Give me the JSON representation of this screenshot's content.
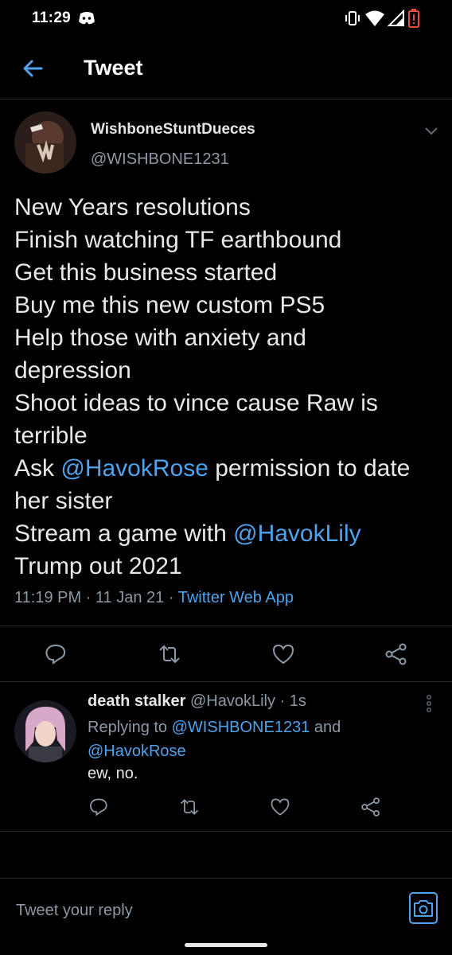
{
  "status_bar": {
    "time": "11:29",
    "icons": [
      "discord-icon",
      "vibrate-icon",
      "wifi-icon",
      "signal-icon",
      "battery-low-icon"
    ]
  },
  "header": {
    "back_icon": "arrow-left-icon",
    "title": "Tweet"
  },
  "tweet": {
    "author_name": "WishboneStuntDueces",
    "author_handle": "@WISHBONE1231",
    "lines": [
      {
        "text": "New Years resolutions"
      },
      {
        "text": "Finish watching TF earthbound"
      },
      {
        "text": "Get this business started"
      },
      {
        "text": "Buy me this new custom PS5"
      },
      {
        "text": "Help those with anxiety and"
      },
      {
        "text": "depression"
      },
      {
        "text": "Shoot ideas to vince cause Raw is"
      },
      {
        "text": "terrible"
      },
      {
        "before": "Ask ",
        "mention": "@HavokRose",
        "after": " permission to date"
      },
      {
        "text": "her sister"
      },
      {
        "before": "Stream a game with ",
        "mention": "@HavokLily",
        "after": ""
      },
      {
        "text": "Trump out 2021"
      }
    ],
    "time": "11:19 PM",
    "date": "11 Jan 21",
    "separator": " · ",
    "source": "Twitter Web App",
    "actions": [
      "reply-icon",
      "retweet-icon",
      "like-icon",
      "share-icon"
    ]
  },
  "reply": {
    "author_name": "death stalker",
    "author_handle": "@HavokLily",
    "age": "1s",
    "replying_prefix": "Replying to ",
    "replying_to_1": "@WISHBONE1231",
    "replying_and": " and",
    "replying_to_2": "@HavokRose",
    "text": "ew, no."
  },
  "compose": {
    "placeholder": "Tweet your reply",
    "camera_icon": "camera-icon"
  },
  "colors": {
    "background": "#000000",
    "accent": "#4ea3ec",
    "muted": "#8b98a5",
    "text": "#e8e8e8"
  }
}
